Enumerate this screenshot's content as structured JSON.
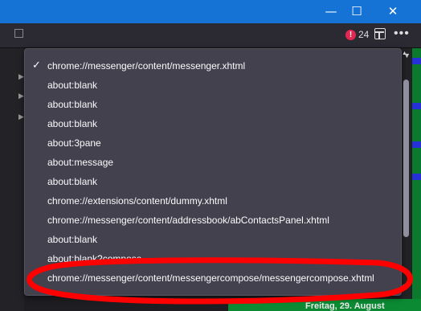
{
  "window": {
    "minimize_glyph": "—",
    "maximize_glyph": "☐",
    "close_glyph": "✕"
  },
  "toolbar": {
    "error_badge_glyph": "!",
    "error_count": "24",
    "frame_icon": "frame-icon",
    "more_glyph": "•••"
  },
  "menu": {
    "checked_glyph": "✓",
    "items": [
      {
        "label": "chrome://messenger/content/messenger.xhtml",
        "checked": true
      },
      {
        "label": "about:blank",
        "checked": false
      },
      {
        "label": "about:blank",
        "checked": false
      },
      {
        "label": "about:blank",
        "checked": false
      },
      {
        "label": "about:3pane",
        "checked": false
      },
      {
        "label": "about:message",
        "checked": false
      },
      {
        "label": "about:blank",
        "checked": false
      },
      {
        "label": "chrome://extensions/content/dummy.xhtml",
        "checked": false
      },
      {
        "label": "chrome://messenger/content/addressbook/abContactsPanel.xhtml",
        "checked": false
      },
      {
        "label": "about:blank",
        "checked": false
      },
      {
        "label": "about:blank?compose",
        "checked": false
      },
      {
        "label": "chrome://messenger/content/messengercompose/messengercompose.xhtml",
        "checked": false
      }
    ]
  },
  "status": {
    "date_text": "Freitag, 29. August"
  },
  "colors": {
    "titlebar": "#1673d6",
    "menu_bg": "#42414d",
    "annotation": "#ff0000",
    "calendar_green": "#0b7a2c",
    "calendar_blue": "#2430d8"
  }
}
